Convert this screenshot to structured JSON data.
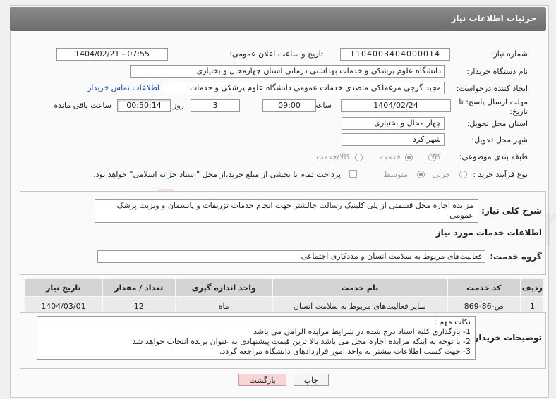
{
  "header": {
    "title": "جزئیات اطلاعات نیاز"
  },
  "need_number": {
    "label": "شماره نیاز:",
    "value": "1104003404000014"
  },
  "announce_datetime": {
    "label": "تاریخ و ساعت اعلان عمومی:",
    "value": "1404/02/21 - 07:55"
  },
  "buyer_org": {
    "label": "نام دستگاه خریدار:",
    "value": "دانشگاه علوم پزشکی و خدمات بهداشتی درمانی استان چهارمحال و بختیاری"
  },
  "requester": {
    "label": "ایجاد کننده درخواست:",
    "value": "مجید گرجی مرغملکی متصدی خدمات عمومی دانشگاه علوم پزشکی و خدمات",
    "contact_link": "اطلاعات تماس خریدار"
  },
  "deadline": {
    "label_line1": "مهلت ارسال پاسخ: تا",
    "label_line2": "تاریخ:",
    "date": "1404/02/24",
    "time_label": "ساعت",
    "time": "09:00",
    "days": "3",
    "days_label": "روز و",
    "remaining": "00:50:14",
    "remaining_label": "ساعت باقی مانده"
  },
  "province": {
    "label": "استان محل تحویل:",
    "value": "چهار محال و بختیاری"
  },
  "city": {
    "label": "شهر محل تحویل:",
    "value": "شهر کرد"
  },
  "category": {
    "label": "طبقه بندی موضوعی:",
    "options": [
      "کالا",
      "خدمت",
      "کالا/خدمت"
    ],
    "selected": "خدمت"
  },
  "purchase_type": {
    "label": "نوع فرآیند خرید :",
    "options": [
      "جزیی",
      "متوسط"
    ],
    "selected": "متوسط",
    "payment_note": "پرداخت تمام یا بخشی از مبلغ خرید،از محل \"اسناد خزانه اسلامی\" خواهد بود."
  },
  "summary": {
    "label": "شرح کلی نیاز:",
    "text": "مزایده اجاره محل قسمتی از  پلی کلینیک رسالت جالشتر جهت انجام خدمات تزریقات و پانسمان و ویزیت پزشک عمومی"
  },
  "services_title": "اطلاعات خدمات مورد نیاز",
  "service_group": {
    "label": "گروه خدمت:",
    "value": "فعالیت‌های مربوط به سلامت انسان و مددکاری اجتماعی"
  },
  "table": {
    "headers": [
      "ردیف",
      "کد خدمت",
      "نام خدمت",
      "واحد اندازه گیری",
      "تعداد / مقدار",
      "تاریخ نیاز"
    ],
    "rows": [
      [
        "1",
        "ص-86-869",
        "سایر فعالیت‌های مربوط به سلامت انسان",
        "ماه",
        "12",
        "1404/03/01"
      ]
    ]
  },
  "notes": {
    "label": "توضیحات خریدار:",
    "lines": [
      "نکات مهم :",
      "1- بارگذاری کلیه اسناد درج شده در شرایط مزایده الزامی می باشد",
      "2- با توجه به اینکه مزایده اجاره محل می باشد بالا ترین قیمت پیشنهادی به عنوان برنده انتخاب خواهد شد",
      "3- جهت کسب اطلاعات بیشتر به واحد امور قراردادهای دانشگاه مراجعه گردد."
    ]
  },
  "buttons": {
    "print": "چاپ",
    "back": "بازگشت"
  },
  "watermark": {
    "text": "AriaTender.neT"
  }
}
